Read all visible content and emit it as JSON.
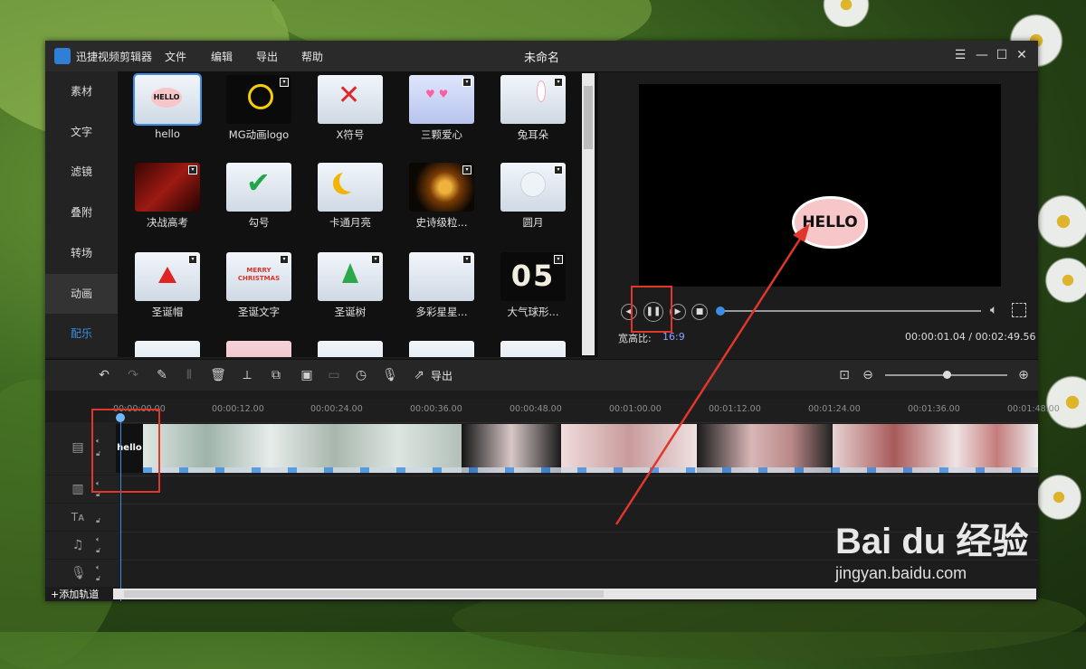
{
  "app": {
    "name": "迅捷视频剪辑器",
    "document_title": "未命名",
    "menus": [
      "文件",
      "编辑",
      "导出",
      "帮助"
    ]
  },
  "sidebar": {
    "items": [
      {
        "label": "素材"
      },
      {
        "label": "文字"
      },
      {
        "label": "滤镜"
      },
      {
        "label": "叠附"
      },
      {
        "label": "转场"
      },
      {
        "label": "动画",
        "active": true
      },
      {
        "label": "配乐",
        "highlight": true
      }
    ]
  },
  "library": {
    "tiles": [
      {
        "label": "hello"
      },
      {
        "label": "MG动画logo"
      },
      {
        "label": "X符号"
      },
      {
        "label": "三颗爱心"
      },
      {
        "label": "兔耳朵"
      },
      {
        "label": "决战高考"
      },
      {
        "label": "勾号"
      },
      {
        "label": "卡通月亮"
      },
      {
        "label": "史诗级粒..."
      },
      {
        "label": "圆月"
      },
      {
        "label": "圣诞帽"
      },
      {
        "label": "圣诞文字"
      },
      {
        "label": "圣诞树"
      },
      {
        "label": "多彩星星..."
      },
      {
        "label": "大气球形..."
      }
    ],
    "tile_texts": {
      "hello": "HELLO",
      "christmas": "MERRY CHRISTMAS",
      "number": "05"
    }
  },
  "preview": {
    "overlay_text": "HELLO",
    "aspect_label": "宽高比:",
    "aspect_value": "16:9",
    "timecode": "00:00:01.04 / 00:02:49.56"
  },
  "toolbar": {
    "export_label": "导出"
  },
  "timeline": {
    "ticks": [
      "00:00:00.00",
      "00:00:12.00",
      "00:00:24.00",
      "00:00:36.00",
      "00:00:48.00",
      "00:01:00.00",
      "00:01:12.00",
      "00:01:24.00",
      "00:01:36.00",
      "00:01:48.00"
    ],
    "hello_clip_label": "hello",
    "add_track_label": "+添加轨道"
  },
  "watermark": {
    "brand": "Bai du 经验",
    "url": "jingyan.baidu.com"
  },
  "colors": {
    "accent": "#3a8ee6",
    "annotation_red": "#e0362c"
  }
}
